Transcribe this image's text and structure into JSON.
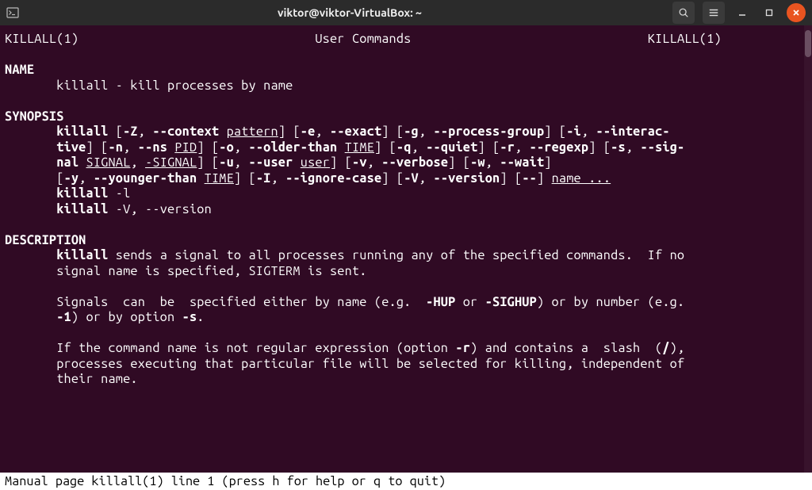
{
  "titlebar": {
    "title": "viktor@viktor-VirtualBox: ~",
    "icons": {
      "terminal": "terminal-icon",
      "search": "search-icon",
      "menu": "menu-icon",
      "minimize": "−",
      "maximize": "□",
      "close": "×"
    }
  },
  "manpage": {
    "header_left": "KILLALL(1)",
    "header_center": "User Commands",
    "header_right": "KILLALL(1)",
    "sections": {
      "name": {
        "heading": "NAME",
        "text": "killall - kill processes by name"
      },
      "synopsis": {
        "heading": "SYNOPSIS",
        "cmd": "killall",
        "line1": {
          "pre": " [",
          "o1": "-Z",
          "s1": ", ",
          "o2": "--context",
          "sp": " ",
          "arg1": "pattern",
          "s2": "] [",
          "o3": "-e",
          "s3": ", ",
          "o4": "--exact",
          "s4": "] [",
          "o5": "-g",
          "s5": ", ",
          "o6": "--process-group",
          "s6": "] [",
          "o7": "-i",
          "s7": ", ",
          "o8": "--interac-"
        },
        "line2": {
          "o1": "tive",
          "s1": "] [",
          "o2": "-n",
          "s2": ", ",
          "o3": "--ns",
          "sp": " ",
          "arg1": "PID",
          "s3": "] [",
          "o4": "-o",
          "s4": ", ",
          "o5": "--older-than",
          "sp2": " ",
          "arg2": "TIME",
          "s5": "] [",
          "o6": "-q",
          "s6": ", ",
          "o7": "--quiet",
          "s7": "] [",
          "o8": "-r",
          "s8": ", ",
          "o9": "--regexp",
          "s9": "] [",
          "o10": "-s",
          "s10": ", ",
          "o11": "--sig-"
        },
        "line3": {
          "o1": "nal",
          "sp": " ",
          "arg1": "SIGNAL",
          "s1": ", ",
          "arg2": "-SIGNAL",
          "s2": "] [",
          "o2": "-u",
          "s3": ", ",
          "o3": "--user",
          "sp2": " ",
          "arg3": "user",
          "s4": "] [",
          "o4": "-v",
          "s5": ", ",
          "o5": "--verbose",
          "s6": "] [",
          "o6": "-w",
          "s7": ", ",
          "o7": "--wait",
          "s8": "]"
        },
        "line4": {
          "s0": "[",
          "o1": "-y",
          "s1": ", ",
          "o2": "--younger-than",
          "sp": " ",
          "arg1": "TIME",
          "s2": "] [",
          "o3": "-I",
          "s3": ", ",
          "o4": "--ignore-case",
          "s4": "] [",
          "o5": "-V",
          "s5": ", ",
          "o6": "--version",
          "s6": "] [",
          "o7": "--",
          "s7": "] ",
          "arg2": "name ..."
        },
        "line5": {
          "cmd": "killall",
          "rest": " -l"
        },
        "line6": {
          "cmd": "killall",
          "rest": " -V, --version"
        }
      },
      "description": {
        "heading": "DESCRIPTION",
        "p1a": "killall",
        "p1b": " sends a signal to all processes running any of the specified commands.  If no",
        "p1c": "signal name is specified, SIGTERM is sent.",
        "p2a": "Signals  can  be  specified either by name (e.g.  ",
        "p2b": "-HUP",
        "p2c": " or ",
        "p2d": "-SIGHUP",
        "p2e": ") or by number (e.g.",
        "p2f": "-1",
        "p2g": ") or by option ",
        "p2h": "-s",
        "p2i": ".",
        "p3a": "If the command name is not regular expression (option ",
        "p3b": "-r",
        "p3c": ") and contains a  slash  (",
        "p3d": "/",
        "p3e": "),",
        "p3f": "processes executing that particular file will be selected for killing, independent of",
        "p3g": "their name."
      }
    },
    "statusline": " Manual page killall(1) line 1 (press h for help or q to quit)"
  }
}
